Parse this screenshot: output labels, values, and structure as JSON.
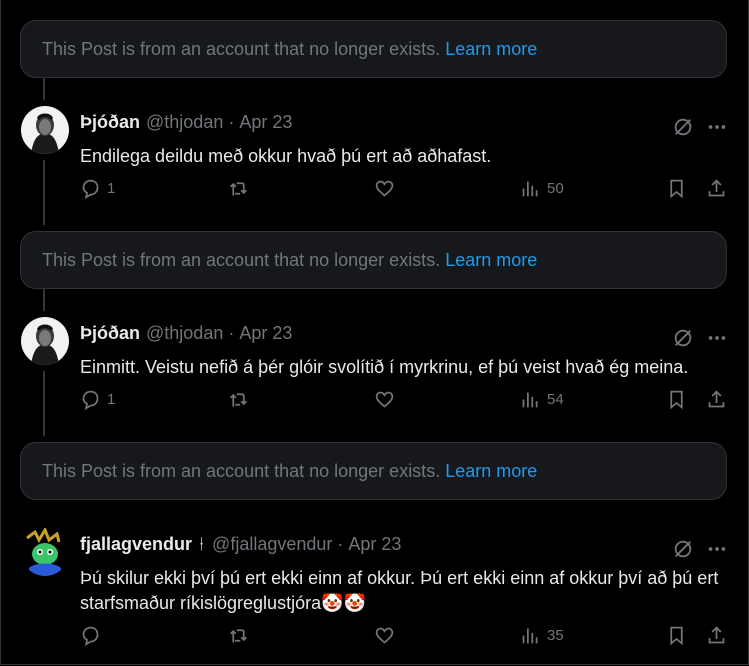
{
  "deleted_notice": {
    "text": "This Post is from an account that no longer exists.",
    "link": "Learn more"
  },
  "posts": [
    {
      "name": "Þjóðan",
      "handle": "@thjodan",
      "separator": "·",
      "date": "Apr 23",
      "text": "Endilega deildu með okkur hvað þú ert að aðhafast.",
      "replies": "1",
      "views": "50"
    },
    {
      "name": "Þjóðan",
      "handle": "@thjodan",
      "separator": "·",
      "date": "Apr 23",
      "text": "Einmitt. Veistu nefið á þér glóir svolítið í myrkrinu, ef þú veist hvað ég meina.",
      "replies": "1",
      "views": "54"
    },
    {
      "name": "fjallagvendur",
      "badge": "ᚽ",
      "handle": "@fjallagvendur",
      "separator": "·",
      "date": "Apr 23",
      "text": "Þú skilur ekki því þú ert ekki einn af okkur. Þú ert ekki einn af okkur því að þú ert starfsmaður ríkislögreglustjóra🤡🤡",
      "replies": "",
      "views": "35"
    }
  ],
  "icons": {
    "grok": "grok-icon",
    "more": "more-icon",
    "reply": "reply-icon",
    "repost": "repost-icon",
    "like": "like-icon",
    "views": "views-icon",
    "bookmark": "bookmark-icon",
    "share": "share-icon"
  },
  "colors": {
    "background": "#000000",
    "link": "#1d9bf0",
    "muted": "#71767b",
    "text": "#e7e9ea"
  }
}
